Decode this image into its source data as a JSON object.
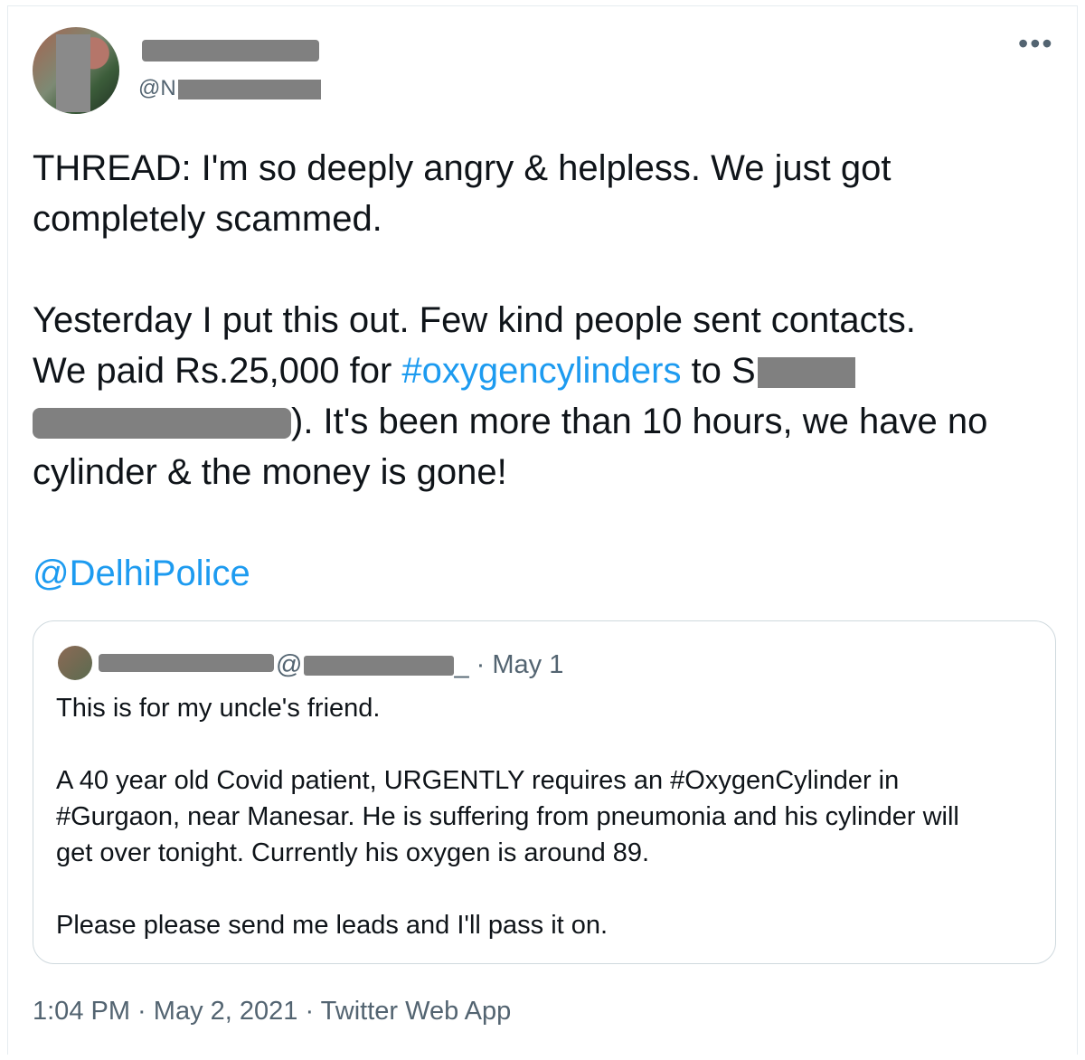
{
  "tweet": {
    "handle_prefix": "@N",
    "more_icon": "more-horizontal-icon",
    "lines": {
      "l1": "THREAD: I'm so deeply angry & helpless. We just got",
      "l2": "completely scammed.",
      "l3": "Yesterday I put this out. Few kind people sent contacts.",
      "l4_a": "We paid Rs.25,000 for ",
      "l4_hashtag": "#oxygencylinders",
      "l4_b": " to S",
      "l5": "). It's been more than 10 hours, we have no",
      "l6": "cylinder & the money is gone!",
      "mention": "@DelhiPolice"
    },
    "link_color": "#1d9bf0"
  },
  "quote": {
    "at": "@",
    "date_sep": "_ · May 1",
    "p1": "This is for my uncle's friend.",
    "p2_l1": "A 40 year old Covid patient, URGENTLY requires an #OxygenCylinder in",
    "p2_l2": "#Gurgaon, near Manesar. He is suffering from pneumonia and his cylinder will",
    "p2_l3": "get over tonight. Currently his oxygen is around 89.",
    "p3": "Please please send me leads and I'll pass it on."
  },
  "footer": {
    "time": "1:04 PM",
    "sep1": " · ",
    "date": "May 2, 2021",
    "sep2": " · ",
    "source": "Twitter Web App"
  }
}
